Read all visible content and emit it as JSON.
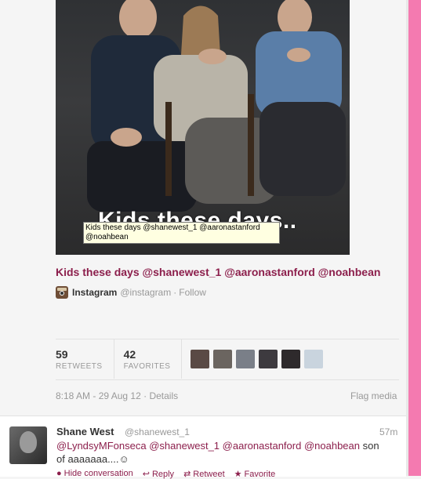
{
  "photo": {
    "caption": "Kids these days..",
    "tooltip": "Kids these days @shanewest_1 @aaronastanford @noahbean"
  },
  "tweet": {
    "text": "Kids these days @shanewest_1 @aaronastanford @noahbean",
    "source_name": "Instagram",
    "source_handle": "@instagram",
    "source_sep": "·",
    "source_follow": "Follow"
  },
  "stats": {
    "retweets_count": "59",
    "retweets_label": "RETWEETS",
    "favorites_count": "42",
    "favorites_label": "FAVORITES",
    "avatar_colors": [
      "#5a4a45",
      "#6b6560",
      "#7a7f88",
      "#3d3a3f",
      "#2e2a2c",
      "#c9d4de"
    ]
  },
  "meta": {
    "timestamp": "8:18 AM - 29 Aug 12",
    "sep": "·",
    "details": "Details",
    "flag": "Flag media"
  },
  "reply": {
    "name": "Shane West",
    "handle": "@shanewest_1",
    "time": "57m",
    "mention1": "@LyndsyMFonseca",
    "mention2": "@shanewest_1",
    "mention3": "@aaronastanford",
    "mention4": "@noahbean",
    "text_rest": "son of aaaaaaa....☺",
    "actions": {
      "hide": "Hide conversation",
      "reply": "Reply",
      "retweet": "Retweet",
      "favorite": "Favorite"
    }
  },
  "colors": {
    "accent": "#8c1f4c",
    "pink_bar": "#f47ab0"
  }
}
